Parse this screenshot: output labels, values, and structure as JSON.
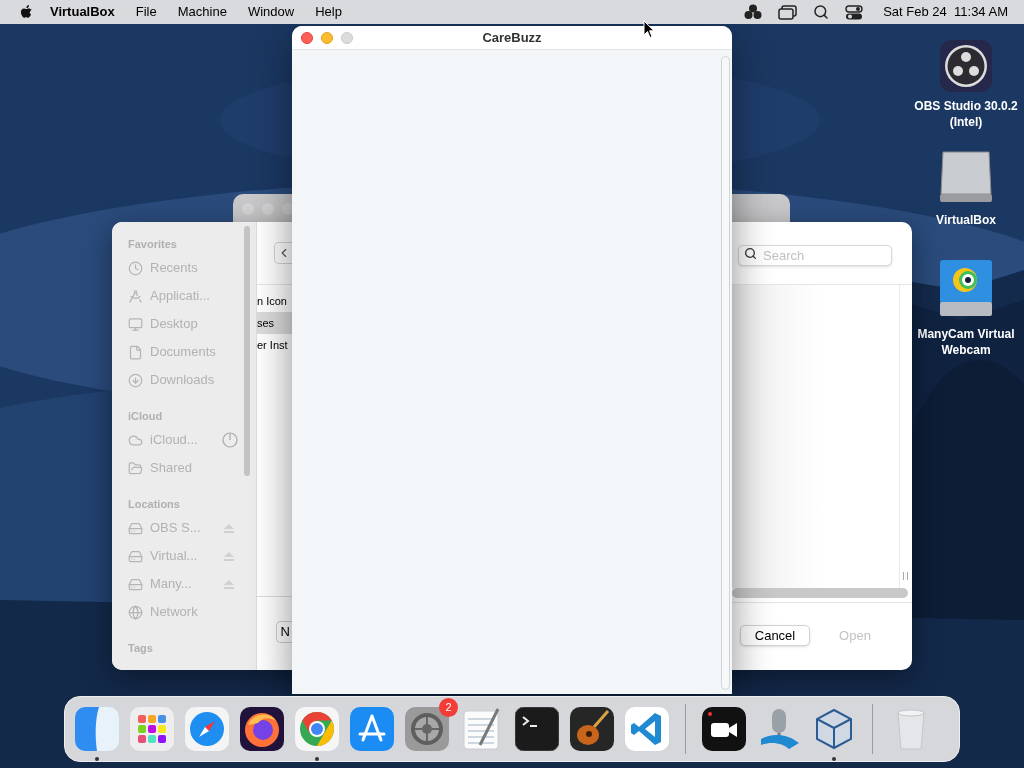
{
  "menu_bar": {
    "app_name": "VirtualBox",
    "menus": [
      "File",
      "Machine",
      "Window",
      "Help"
    ],
    "clock": "Sat Feb 24  11:34 AM"
  },
  "desktop_icons": [
    {
      "label": "OBS Studio 30.0.2 (Intel)",
      "kind": "obs"
    },
    {
      "label": "VirtualBox",
      "kind": "disk"
    },
    {
      "label": "ManyCam Virtual Webcam",
      "kind": "manycam"
    }
  ],
  "open_dialog": {
    "sidebar": [
      {
        "header": "Favorites",
        "items": [
          {
            "label": "Recents",
            "kind": "recents"
          },
          {
            "label": "Applicati...",
            "kind": "applications"
          },
          {
            "label": "Desktop",
            "kind": "desktop"
          },
          {
            "label": "Documents",
            "kind": "documents"
          },
          {
            "label": "Downloads",
            "kind": "downloads"
          }
        ]
      },
      {
        "header": "iCloud",
        "items": [
          {
            "label": "iCloud...",
            "kind": "cloud"
          },
          {
            "label": "Shared",
            "kind": "shared"
          }
        ]
      },
      {
        "header": "Locations",
        "items": [
          {
            "label": "OBS S...",
            "kind": "drive"
          },
          {
            "label": "Virtual...",
            "kind": "drive"
          },
          {
            "label": "Many...",
            "kind": "drive"
          },
          {
            "label": "Network",
            "kind": "network"
          }
        ]
      },
      {
        "header": "Tags"
      }
    ],
    "list_rows": [
      {
        "label": "n Icon",
        "selected": false
      },
      {
        "label": "ses",
        "selected": true
      },
      {
        "label": "er Inst",
        "selected": false
      }
    ],
    "left_button": "N",
    "search": {
      "placeholder": "Search"
    },
    "buttons": [
      {
        "label": "Cancel",
        "disabled": false
      },
      {
        "label": "Open",
        "disabled": true
      }
    ]
  },
  "carebuzz_window": {
    "title": "CareBuzz"
  },
  "dock": [
    {
      "kind": "finder",
      "running": true
    },
    {
      "kind": "launchpad",
      "running": false
    },
    {
      "kind": "safari",
      "running": false
    },
    {
      "kind": "firefox",
      "running": false
    },
    {
      "kind": "chrome",
      "running": true
    },
    {
      "kind": "appstore",
      "running": false
    },
    {
      "kind": "settings",
      "running": false,
      "badge": "2"
    },
    {
      "kind": "textedit",
      "running": false
    },
    {
      "kind": "terminal",
      "running": false
    },
    {
      "kind": "garageband",
      "running": false
    },
    {
      "kind": "vscode",
      "running": false
    },
    {
      "kind": "separator"
    },
    {
      "kind": "recorder",
      "running": false
    },
    {
      "kind": "mic",
      "running": false
    },
    {
      "kind": "virtualbox",
      "running": true
    },
    {
      "kind": "separator"
    },
    {
      "kind": "trash",
      "running": false
    }
  ]
}
